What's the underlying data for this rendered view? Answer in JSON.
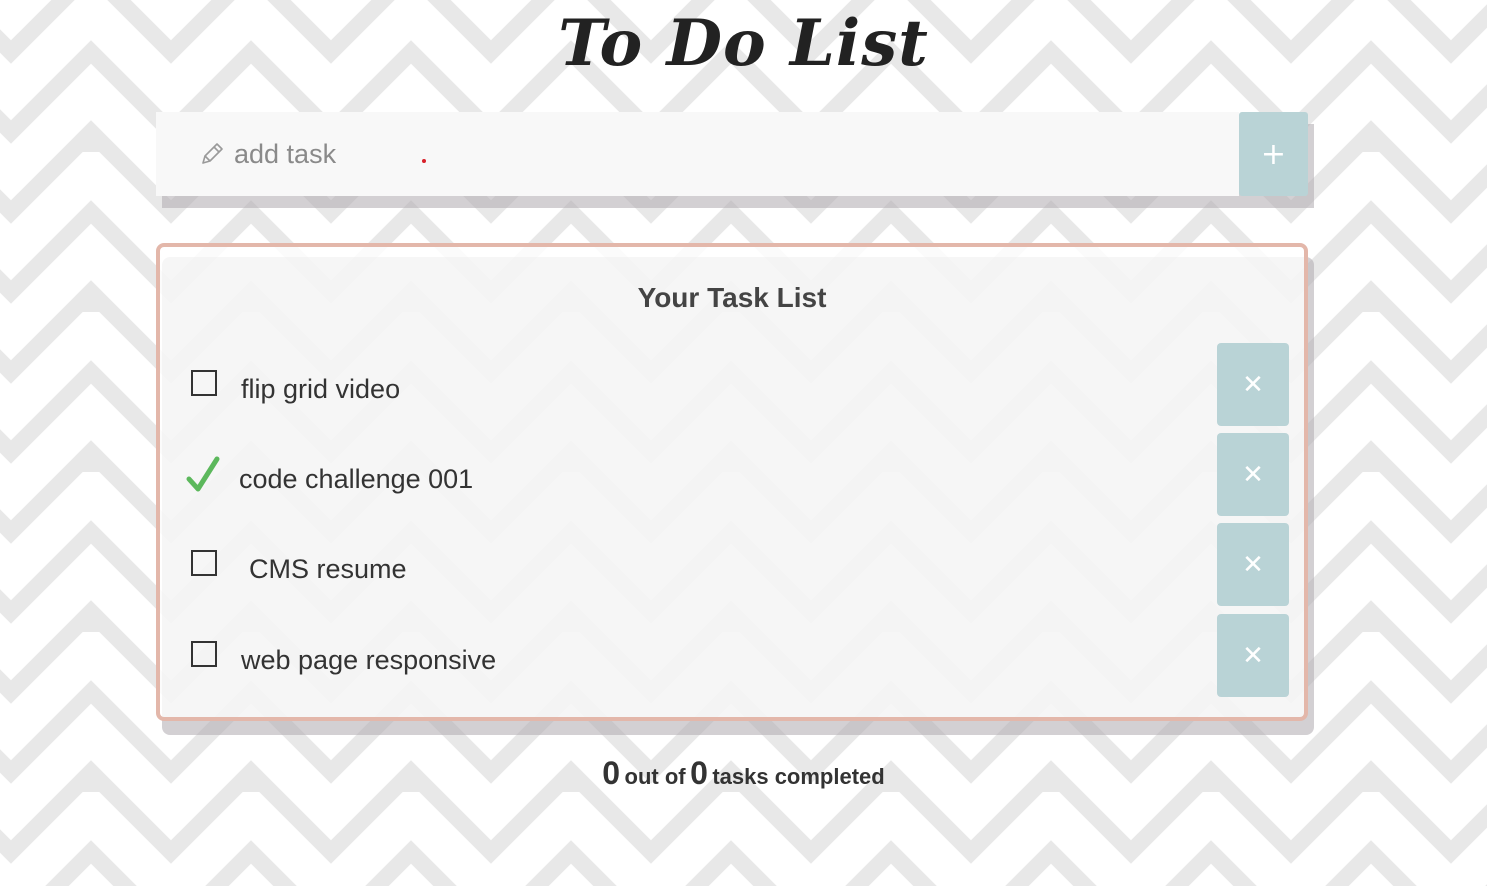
{
  "app": {
    "title": "To Do List"
  },
  "add_form": {
    "placeholder": "add task",
    "input_value": "",
    "add_label": "+",
    "icon": "pencil-icon"
  },
  "task_list": {
    "heading": "Your Task List",
    "tasks": [
      {
        "label": "flip grid video",
        "completed": false,
        "delete_label": "✕"
      },
      {
        "label": "code challenge 001",
        "completed": true,
        "delete_label": "✕"
      },
      {
        "label": "CMS resume",
        "completed": false,
        "delete_label": "✕"
      },
      {
        "label": "web page responsive",
        "completed": false,
        "delete_label": "✕"
      }
    ]
  },
  "counter": {
    "completed": "0",
    "middle_text": "out of",
    "total": "0",
    "suffix_text": "tasks completed"
  },
  "colors": {
    "accent": "#b9d3d6",
    "card_border": "#e3b7aa",
    "check_green": "#5cb85c",
    "background": "#e8e8e8"
  }
}
